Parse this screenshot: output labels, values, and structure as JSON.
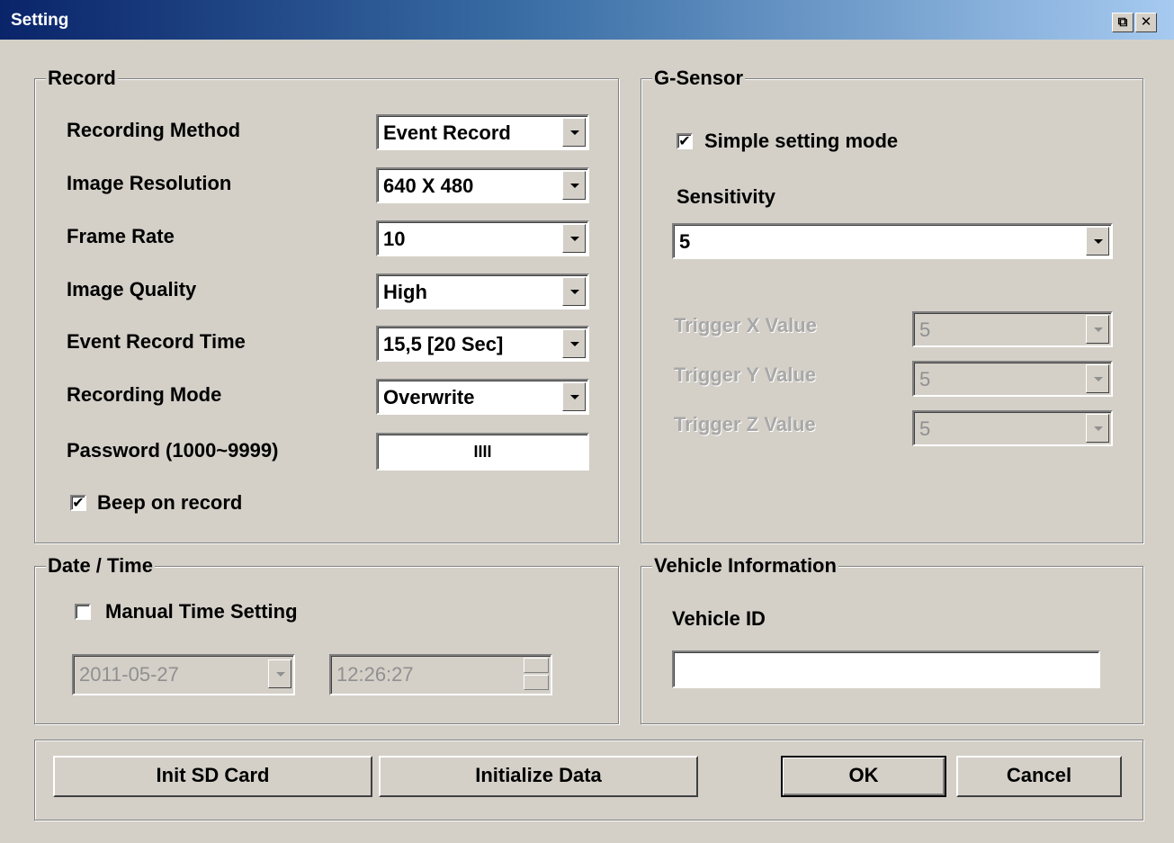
{
  "window": {
    "title": "Setting",
    "restore_glyph": "⧉",
    "close_glyph": "✕"
  },
  "record": {
    "title": "Record",
    "rows": [
      {
        "label": "Recording Method",
        "value": "Event Record"
      },
      {
        "label": "Image Resolution",
        "value": "640 X 480"
      },
      {
        "label": "Frame Rate",
        "value": "10"
      },
      {
        "label": "Image Quality",
        "value": "High"
      },
      {
        "label": "Event Record Time",
        "value": "15,5  [20 Sec]"
      },
      {
        "label": "Recording Mode",
        "value": "Overwrite"
      }
    ],
    "password_label": "Password (1000~9999)",
    "password_value": "IIII",
    "beep_label": "Beep on record",
    "beep_checked": true
  },
  "gsensor": {
    "title": "G-Sensor",
    "simple_mode_label": "Simple setting mode",
    "simple_mode_checked": true,
    "sensitivity_label": "Sensitivity",
    "sensitivity_value": "5",
    "triggers": [
      {
        "label": "Trigger X Value",
        "value": "5"
      },
      {
        "label": "Trigger Y Value",
        "value": "5"
      },
      {
        "label": "Trigger Z Value",
        "value": "5"
      }
    ]
  },
  "datetime": {
    "title": "Date / Time",
    "manual_label": "Manual Time Setting",
    "manual_checked": false,
    "date_value": "2011-05-27",
    "time_value": "12:26:27"
  },
  "vehicle": {
    "title": "Vehicle Information",
    "id_label": "Vehicle ID",
    "id_value": ""
  },
  "buttons": {
    "init_sd": "Init SD Card",
    "init_data": "Initialize Data",
    "ok": "OK",
    "cancel": "Cancel"
  },
  "icons": {
    "check": "✔"
  }
}
